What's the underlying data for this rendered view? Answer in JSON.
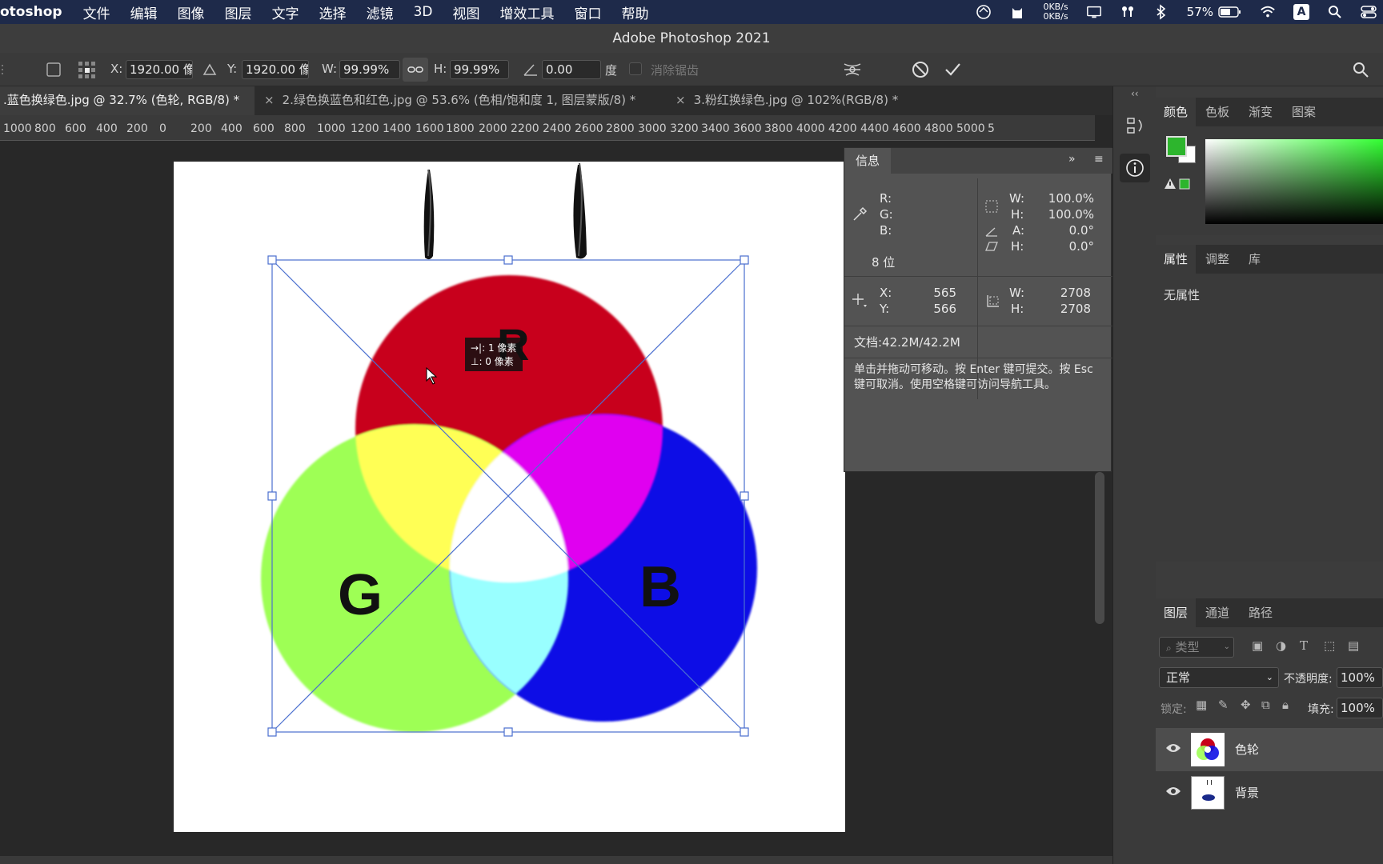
{
  "menubar": {
    "app_name": "otoshop",
    "items": [
      "文件",
      "编辑",
      "图像",
      "图层",
      "文字",
      "选择",
      "滤镜",
      "3D",
      "视图",
      "增效工具",
      "窗口",
      "帮助"
    ],
    "net_up": "0KB/s",
    "net_down": "0KB/s",
    "battery": "57%",
    "input_method": "A"
  },
  "window_title": "Adobe Photoshop 2021",
  "options": {
    "x_label": "X:",
    "x_value": "1920.00 像",
    "y_label": "Y:",
    "y_value": "1920.00 像",
    "w_label": "W:",
    "w_value": "99.99%",
    "h_label": "H:",
    "h_value": "99.99%",
    "angle_value": "0.00",
    "angle_unit": "度",
    "antialias_label": "消除锯齿"
  },
  "doc_tabs": [
    {
      "label": ".蓝色换绿色.jpg @ 32.7% (色轮, RGB/8) *",
      "active": true
    },
    {
      "label": "2.绿色换蓝色和红色.jpg @ 53.6% (色相/饱和度 1, 图层蒙版/8) *",
      "active": false
    },
    {
      "label": "3.粉红换绿色.jpg @ 102%(RGB/8) *",
      "active": false
    }
  ],
  "ruler": [
    "1000",
    "800",
    "600",
    "400",
    "200",
    "0",
    "200",
    "400",
    "600",
    "800",
    "1000",
    "1200",
    "1400",
    "1600",
    "1800",
    "2000",
    "2200",
    "2400",
    "2600",
    "2800",
    "3000",
    "3200",
    "3400",
    "3600",
    "3800",
    "4000",
    "4200",
    "4400",
    "4600",
    "4800",
    "5000",
    "5"
  ],
  "canvas": {
    "circle_labels": {
      "r": "R",
      "g": "G",
      "b": "B"
    },
    "tooltip_line1": "→|: 1 像素",
    "tooltip_line2": "⊥: 0 像素"
  },
  "info_panel": {
    "tab": "信息",
    "r_label": "R:",
    "g_label": "G:",
    "b_label": "B:",
    "bits": "8 位",
    "w_label": "W:",
    "w_value": "100.0%",
    "h_label": "H:",
    "h_value": "100.0%",
    "a_label": "A:",
    "a_value": "0.0°",
    "hh_label": "H:",
    "hh_value": "0.0°",
    "x_label": "X:",
    "x_value": "565",
    "y_label": "Y:",
    "y_value": "566",
    "w2_label": "W:",
    "w2_value": "2708",
    "h2_label": "H:",
    "h2_value": "2708",
    "doc_size": "文档:42.2M/42.2M",
    "hint": "单击并拖动可移动。按 Enter 键可提交。按 Esc 键可取消。使用空格键可访问导航工具。"
  },
  "color_panel": {
    "tabs": [
      "颜色",
      "色板",
      "渐变",
      "图案"
    ],
    "foreground": "#2db52d",
    "background": "#ffffff"
  },
  "props_panel": {
    "tabs": [
      "属性",
      "调整",
      "库"
    ],
    "empty": "无属性"
  },
  "layers_panel": {
    "tabs": [
      "图层",
      "通道",
      "路径"
    ],
    "filter_placeholder": "类型",
    "blend_mode": "正常",
    "opacity_label": "不透明度:",
    "opacity_value": "100%",
    "lock_label": "锁定:",
    "fill_label": "填充:",
    "fill_value": "100%",
    "layers": [
      {
        "name": "色轮",
        "active": true
      },
      {
        "name": "背景",
        "active": false
      }
    ]
  }
}
